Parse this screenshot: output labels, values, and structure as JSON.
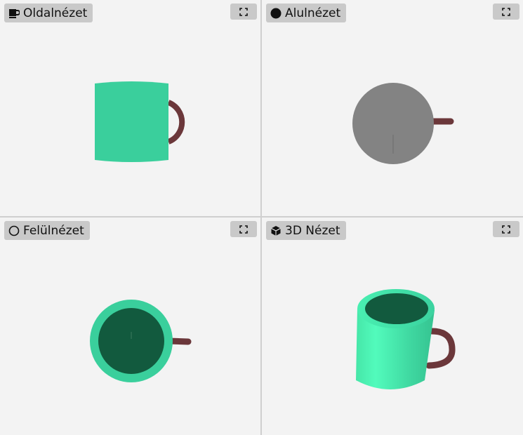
{
  "views": [
    {
      "label": "Oldalnézet",
      "icon": "mug-icon"
    },
    {
      "label": "Alulnézet",
      "icon": "filled-circle-icon"
    },
    {
      "label": "Felülnézet",
      "icon": "outline-circle-icon"
    },
    {
      "label": "3D Nézet",
      "icon": "cube-icon"
    }
  ],
  "colors": {
    "mug_body": "#3ACF9C",
    "mug_interior": "#125A3E",
    "mug_bottom": "#838383",
    "handle": "#6B373A",
    "pane_bg": "#F3F3F3",
    "label_bg": "#C9C9C9"
  }
}
